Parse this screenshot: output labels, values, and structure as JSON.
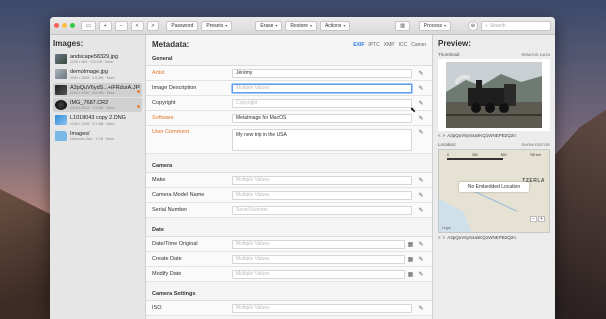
{
  "toolbar": {
    "back": "<",
    "forward": ">",
    "buttons": [
      {
        "label": "Password"
      },
      {
        "label": "Presets"
      },
      {
        "label": "Erase"
      },
      {
        "label": "Restore"
      },
      {
        "label": "Actions"
      },
      {
        "label": "Process"
      }
    ],
    "search_placeholder": "Search"
  },
  "images": {
    "title": "Images:",
    "items": [
      {
        "name": "andscape58329.jpg",
        "sub": "1239 x 969 · 370 KB · More"
      },
      {
        "name": "demoImage.jpg",
        "sub": "4992 x 3328 · 2.5 MB · More"
      },
      {
        "name": "A3pQuV6ydS...+iFRdurA.JPG",
        "sub": "6000 x 4000 · 8.6 MB · More"
      },
      {
        "name": "IMG_7687.CR2",
        "sub": "4416 x 3312 · 7.6 MB · More"
      },
      {
        "name": "L1018043 copy 2.DNG",
        "sub": "1296 x 1296 · 3.1 MB · More"
      },
      {
        "name": "Images/",
        "sub": "Unknown Size · 1 KB · More"
      }
    ]
  },
  "metadata": {
    "title": "Metadata:",
    "tabs": [
      "EXIF",
      "IPTC",
      "XMP",
      "ICC",
      "Canon"
    ],
    "sections": {
      "general": "General",
      "camera": "Camera",
      "date": "Date",
      "camera_settings": "Camera Settings"
    },
    "general": [
      {
        "label": "Artist",
        "value": "Jérémy",
        "placeholder": ""
      },
      {
        "label": "Image Description",
        "value": "",
        "placeholder": "Multiple Values"
      },
      {
        "label": "Copyright",
        "value": "",
        "placeholder": "Copyright"
      },
      {
        "label": "Software",
        "value": "MetaImage for MacOS",
        "placeholder": ""
      },
      {
        "label": "User Comment",
        "value": "My new trip in the USA",
        "placeholder": ""
      }
    ],
    "camera": [
      {
        "label": "Make",
        "placeholder": "Multiple Values"
      },
      {
        "label": "Camera Model Name",
        "placeholder": "Multiple Values"
      },
      {
        "label": "Serial Number",
        "placeholder": "Serial Number"
      }
    ],
    "date": [
      {
        "label": "Date/Time Original",
        "placeholder": "Multiple Values"
      },
      {
        "label": "Create Date",
        "placeholder": "Multiple Values"
      },
      {
        "label": "Modify Date",
        "placeholder": "Multiple Values"
      }
    ],
    "camera_settings": [
      {
        "label": "ISO",
        "placeholder": "Multiple Values"
      }
    ]
  },
  "preview": {
    "title": "Preview:",
    "thumbnail_label": "Thumbnail:",
    "remove_data": "REMOVE DATA",
    "thumb_name": "A3pQuV6yS4aiIKQ1WNEPB2Q2n",
    "location_label": "Location:",
    "show_editor": "SHOW EDITOR",
    "map_scale": [
      "0",
      "250",
      "500",
      "750 km"
    ],
    "no_location": "No Embedded Location",
    "map_place": "TZERLA",
    "map_legal": "Legal",
    "map_name": "A3pQuV6yS4aiIKQ1WNEPB2Q2n",
    "prev": "<",
    "next": ">",
    "zoom_minus": "−",
    "zoom_plus": "+"
  },
  "colors": {
    "accent": "#2a7de1",
    "orange": "#e0742a"
  },
  "icons": [
    "back-icon",
    "forward-icon",
    "chevron-down-icon",
    "search-icon",
    "pencil-icon",
    "calendar-icon",
    "cursor-icon",
    "sidebar-icon",
    "settings-icon"
  ]
}
